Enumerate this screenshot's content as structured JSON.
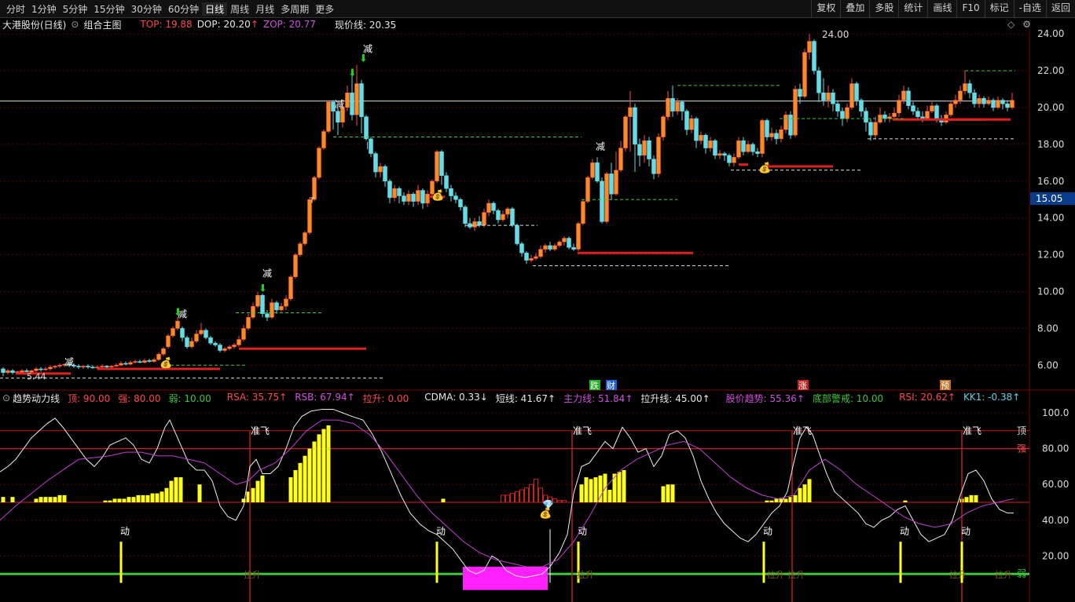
{
  "toolbar": {
    "periods": [
      "分时",
      "1分钟",
      "5分钟",
      "15分钟",
      "30分钟",
      "60分钟",
      "日线",
      "周线",
      "月线",
      "多周期",
      "更多"
    ],
    "tools": [
      "复权",
      "叠加",
      "多股",
      "统计",
      "画线",
      "F10",
      "标记",
      "-自选",
      "返回"
    ]
  },
  "main": {
    "stock_name": "大港股份(日线)",
    "layout_label": "组合主图",
    "top_label": "TOP: 19.88",
    "dop_label": "DOP: 20.20",
    "zop_label": "ZOP: 20.77",
    "price_line_label": "现价线: 20.35",
    "y_ticks": [
      "24.00",
      "22.00",
      "20.00",
      "18.00",
      "16.00",
      "14.00",
      "12.00",
      "10.00",
      "8.00",
      "6.00"
    ],
    "current_price": "15.05",
    "high_label": "24.00",
    "low_label": "5.44",
    "signal_label": "减",
    "event_tags": [
      "跌",
      "财",
      "涨",
      "预"
    ]
  },
  "indicator": {
    "name": "趋势动力线",
    "items": [
      {
        "text": "顶: 90.00",
        "color": "#ff4a4a"
      },
      {
        "text": "强: 80.00",
        "color": "#ff4a4a"
      },
      {
        "text": "弱: 10.00",
        "color": "#3ec83e"
      },
      {
        "text": "RSA: 35.75↑",
        "color": "#ff4a4a"
      },
      {
        "text": "RSB: 67.94↑",
        "color": "#d050e0"
      },
      {
        "text": "拉升: 0.00",
        "color": "#ff4a4a"
      },
      {
        "text": "CDMA: 0.33↓",
        "color": "#e8e8e8"
      },
      {
        "text": "短线: 41.67↑",
        "color": "#e8e8e8"
      },
      {
        "text": "主力线: 51.84↑",
        "color": "#d050e0"
      },
      {
        "text": "拉升线: 45.00↑",
        "color": "#e8e8e8"
      },
      {
        "text": "股价趋势: 55.36↑",
        "color": "#d050e0"
      },
      {
        "text": "底部警戒: 10.00",
        "color": "#3ec83e"
      },
      {
        "text": "RSI: 20.62↑",
        "color": "#ff4a4a"
      },
      {
        "text": "KK1: -0.38↑",
        "color": "#60d0e0"
      }
    ],
    "y_ticks": [
      "100.0",
      "80.00",
      "60.00",
      "40.00",
      "20.00"
    ],
    "right_labels": [
      "顶",
      "强",
      "弱"
    ],
    "signal_zhunfei": "准飞",
    "signal_dong": "动",
    "signal_lasheng": "拉升"
  },
  "colors": {
    "up": "#ff4a4a",
    "down": "#5fdfe8",
    "yellow": "#ffff20",
    "magenta": "#ff20ff",
    "green": "#3ec83e",
    "grid": "#5a0000"
  }
}
